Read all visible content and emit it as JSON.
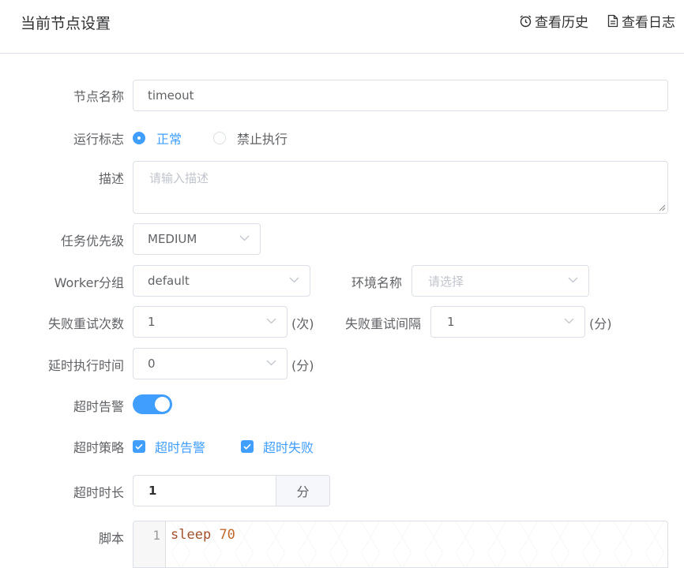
{
  "header": {
    "title": "当前节点设置",
    "history_link": "查看历史",
    "log_link": "查看日志"
  },
  "form": {
    "node_name": {
      "label": "节点名称",
      "value": "timeout"
    },
    "run_flag": {
      "label": "运行标志",
      "options": [
        "正常",
        "禁止执行"
      ],
      "selected": "正常"
    },
    "description": {
      "label": "描述",
      "placeholder": "请输入描述"
    },
    "priority": {
      "label": "任务优先级",
      "value": "MEDIUM"
    },
    "worker_group": {
      "label": "Worker分组",
      "value": "default"
    },
    "environment": {
      "label": "环境名称",
      "placeholder": "请选择"
    },
    "retry_times": {
      "label": "失败重试次数",
      "value": "1",
      "unit": "(次)"
    },
    "retry_interval": {
      "label": "失败重试间隔",
      "value": "1",
      "unit": "(分)"
    },
    "delay_time": {
      "label": "延时执行时间",
      "value": "0",
      "unit": "(分)"
    },
    "timeout_alarm": {
      "label": "超时告警",
      "enabled": true
    },
    "timeout_strategy": {
      "label": "超时策略",
      "options": [
        "超时告警",
        "超时失败"
      ],
      "checked": [
        true,
        true
      ]
    },
    "timeout_duration": {
      "label": "超时时长",
      "value": "1",
      "unit": "分"
    },
    "script": {
      "label": "脚本",
      "line_number": "1",
      "code_keyword": "sleep",
      "code_arg": "70"
    }
  },
  "colors": {
    "accent": "#409eff",
    "border": "#dcdfe6",
    "keyword": "#a0522d",
    "number": "#c0692d"
  }
}
